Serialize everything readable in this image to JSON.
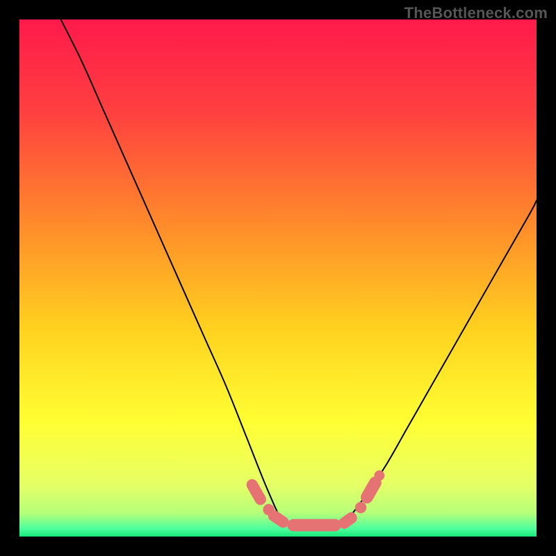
{
  "watermark": "TheBottleneck.com",
  "chart_data": {
    "type": "line",
    "title": "",
    "xlabel": "",
    "ylabel": "",
    "xlim": [
      0,
      100
    ],
    "ylim": [
      0,
      100
    ],
    "grid": false,
    "legend": false,
    "annotations": [],
    "gradient_stops": [
      {
        "pos": 0.0,
        "color": "#ff1a4b"
      },
      {
        "pos": 0.18,
        "color": "#ff4040"
      },
      {
        "pos": 0.4,
        "color": "#ff8c2a"
      },
      {
        "pos": 0.6,
        "color": "#ffd21f"
      },
      {
        "pos": 0.78,
        "color": "#ffff33"
      },
      {
        "pos": 0.9,
        "color": "#e6ff66"
      },
      {
        "pos": 0.955,
        "color": "#b5ff7a"
      },
      {
        "pos": 0.985,
        "color": "#4dff9e"
      },
      {
        "pos": 1.0,
        "color": "#18e87b"
      }
    ],
    "series": [
      {
        "name": "left-branch",
        "x": [
          8,
          12,
          16,
          20,
          24,
          28,
          32,
          36,
          40,
          44,
          48,
          51
        ],
        "y": [
          100,
          92,
          83,
          74,
          65,
          56,
          47,
          38,
          29,
          19,
          9,
          3
        ]
      },
      {
        "name": "valley",
        "x": [
          51,
          54,
          57,
          60,
          63
        ],
        "y": [
          3,
          2,
          2,
          2,
          3
        ]
      },
      {
        "name": "right-branch",
        "x": [
          63,
          67,
          71,
          75,
          79,
          83,
          87,
          91,
          95,
          99,
          100
        ],
        "y": [
          3,
          8,
          14,
          21,
          28,
          35,
          42,
          49,
          56,
          63,
          65
        ]
      }
    ],
    "markers": [
      {
        "shape": "capsule",
        "x1": 45.0,
        "y1": 10.0,
        "x2": 46.6,
        "y2": 7.2,
        "r": 1.1
      },
      {
        "shape": "dot",
        "x": 48.2,
        "y": 5.2,
        "r": 1.1
      },
      {
        "shape": "capsule",
        "x1": 49.2,
        "y1": 4.0,
        "x2": 51.0,
        "y2": 2.8,
        "r": 1.1
      },
      {
        "shape": "capsule",
        "x1": 53.0,
        "y1": 2.2,
        "x2": 61.0,
        "y2": 2.2,
        "r": 1.2
      },
      {
        "shape": "capsule",
        "x1": 62.8,
        "y1": 2.6,
        "x2": 64.2,
        "y2": 3.6,
        "r": 1.1
      },
      {
        "shape": "dot",
        "x": 66.0,
        "y": 5.6,
        "r": 1.1
      },
      {
        "shape": "capsule",
        "x1": 67.2,
        "y1": 7.6,
        "x2": 68.8,
        "y2": 10.4,
        "r": 1.2
      },
      {
        "shape": "dot",
        "x": 69.6,
        "y": 11.8,
        "r": 1.0
      }
    ],
    "marker_color": "#e57373",
    "curve_color": "#000000"
  }
}
